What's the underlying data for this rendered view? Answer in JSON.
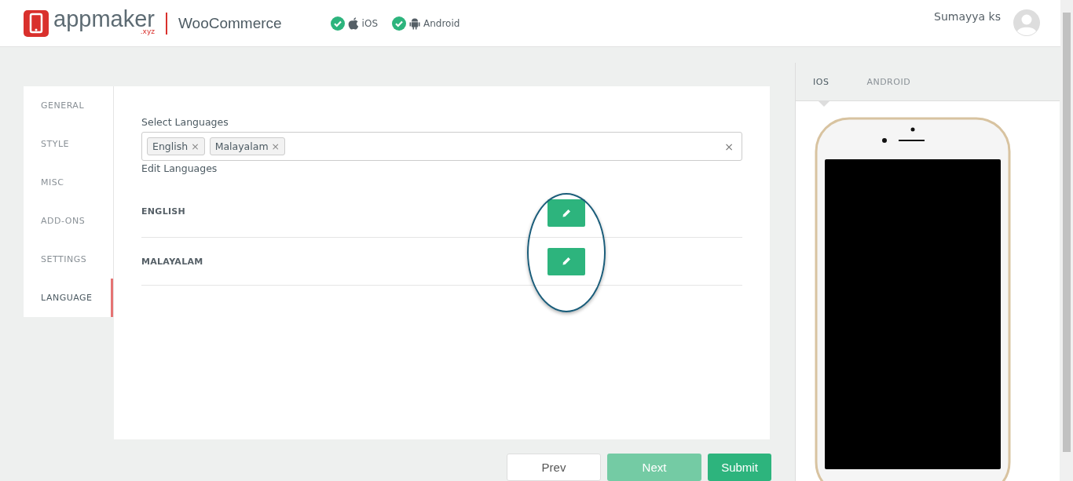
{
  "header": {
    "logo": {
      "name": "appmaker",
      "suffix": ".xyz"
    },
    "product": "WooCommerce",
    "platforms": [
      {
        "label": "iOS",
        "kind": "apple",
        "checked": true
      },
      {
        "label": "Android",
        "kind": "android",
        "checked": true
      }
    ],
    "user": {
      "name": "Sumayya ks"
    }
  },
  "sidebar": {
    "items": [
      {
        "label": "GENERAL",
        "selected": false
      },
      {
        "label": "STYLE",
        "selected": false
      },
      {
        "label": "MISC",
        "selected": false
      },
      {
        "label": "ADD-ONS",
        "selected": false
      },
      {
        "label": "SETTINGS",
        "selected": false
      },
      {
        "label": "LANGUAGE",
        "selected": true
      }
    ]
  },
  "form": {
    "select_label": "Select Languages",
    "tags": [
      "English",
      "Malayalam"
    ],
    "tag_remove": "×",
    "clear": "×",
    "edit_label": "Edit Languages",
    "languages": [
      "ENGLISH",
      "MALAYALAM"
    ]
  },
  "buttons": [
    {
      "label": "Prev",
      "kind": "plain",
      "disabled": false
    },
    {
      "label": "Next",
      "kind": "primary",
      "disabled": true
    },
    {
      "label": "Submit",
      "kind": "primary",
      "disabled": false
    }
  ],
  "preview": {
    "tabs": [
      {
        "label": "IOS",
        "selected": true
      },
      {
        "label": "ANDROID",
        "selected": false
      }
    ]
  }
}
